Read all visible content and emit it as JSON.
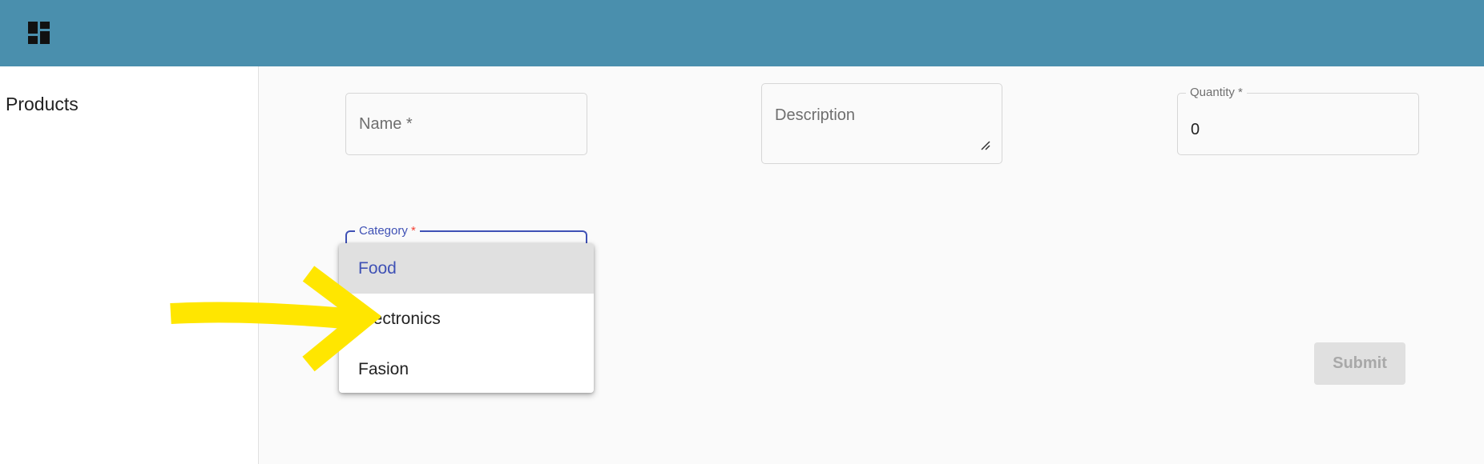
{
  "header": {
    "icon": "dashboard-icon",
    "color": "#4a8fad"
  },
  "sidebar": {
    "items": [
      {
        "label": "Products"
      }
    ]
  },
  "form": {
    "name": {
      "placeholder": "Name *"
    },
    "description": {
      "placeholder": "Description"
    },
    "quantity": {
      "label": "Quantity *",
      "value": "0"
    },
    "category": {
      "label": "Category",
      "required_mark": "*",
      "options": [
        {
          "label": "Food",
          "selected": true
        },
        {
          "label": "Electronics",
          "selected": false
        },
        {
          "label": "Fasion",
          "selected": false
        }
      ]
    },
    "submit_label": "Submit"
  },
  "colors": {
    "accent": "#3f51b5",
    "required": "#f44336",
    "annotation": "#ffe600"
  }
}
